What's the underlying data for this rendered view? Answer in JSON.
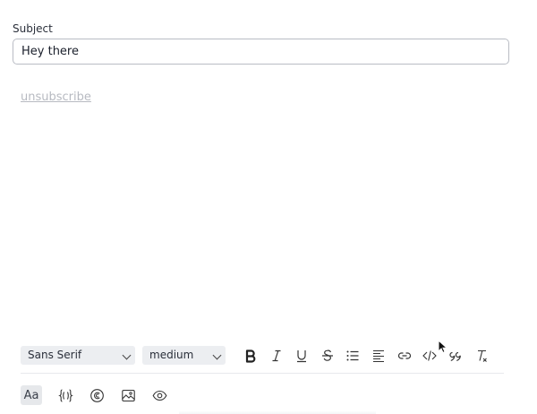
{
  "subject": {
    "label": "Subject",
    "value": "Hey there"
  },
  "body": {
    "unsubscribe_link": "unsubscribe"
  },
  "toolbar": {
    "font_family": "Sans Serif",
    "font_size": "medium",
    "format_buttons": [
      {
        "name": "bold-icon"
      },
      {
        "name": "italic-icon"
      },
      {
        "name": "underline-icon"
      },
      {
        "name": "strikethrough-icon"
      },
      {
        "name": "bullet-list-icon"
      },
      {
        "name": "align-left-icon"
      },
      {
        "name": "link-icon"
      },
      {
        "name": "code-icon"
      },
      {
        "name": "quote-icon"
      },
      {
        "name": "clear-format-icon"
      }
    ],
    "bottom_buttons": [
      {
        "name": "text-style-icon",
        "label": "Aa"
      },
      {
        "name": "variable-braces-icon"
      },
      {
        "name": "copyright-icon"
      },
      {
        "name": "image-icon"
      },
      {
        "name": "preview-eye-icon"
      }
    ]
  }
}
